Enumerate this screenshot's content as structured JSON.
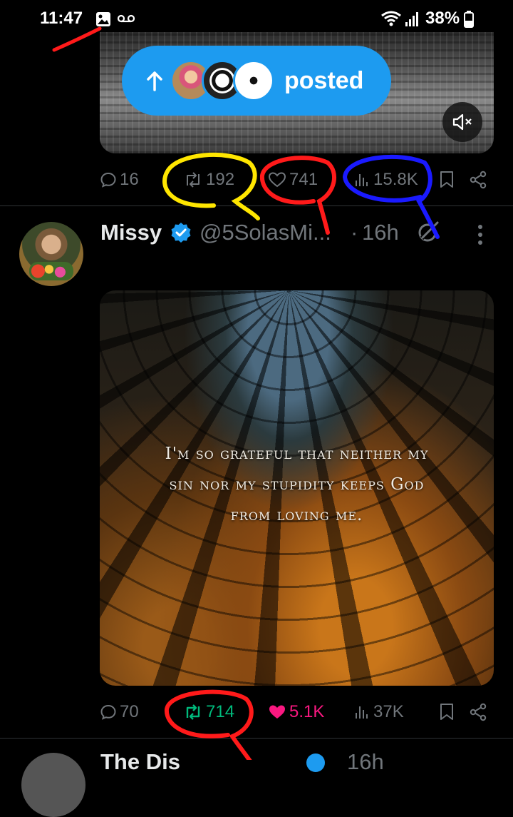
{
  "status_bar": {
    "time": "11:47",
    "battery": "38%",
    "icons": [
      "image-notification-icon",
      "voicemail-icon",
      "wifi-icon",
      "signal-icon",
      "battery-icon"
    ]
  },
  "posted_pill": {
    "label": "posted",
    "icons": [
      "arrow-up-icon"
    ]
  },
  "prev_post": {
    "actions": {
      "replies": "16",
      "reposts": "192",
      "likes": "741",
      "views": "15.8K"
    }
  },
  "post": {
    "author_name": "Missy",
    "handle": "@5SolasMi...",
    "separator": "·",
    "time": "16h",
    "image_quote_lines": [
      "I'm so grateful that neither my",
      "sin nor my stupidity keeps God",
      "from loving me."
    ],
    "actions": {
      "replies": "70",
      "reposts": "714",
      "likes": "5.1K",
      "views": "37K"
    },
    "repost_active": true,
    "like_active": true
  },
  "next_post": {
    "author_name": "The Dis",
    "time": "16h"
  },
  "colors": {
    "accent": "#1d9bf0",
    "repost_green": "#00ba7c",
    "like_pink": "#f91880",
    "muted": "#71767b",
    "annotation_red": "#ff1a1a",
    "annotation_yellow": "#ffe600",
    "annotation_blue": "#1a1aff"
  }
}
